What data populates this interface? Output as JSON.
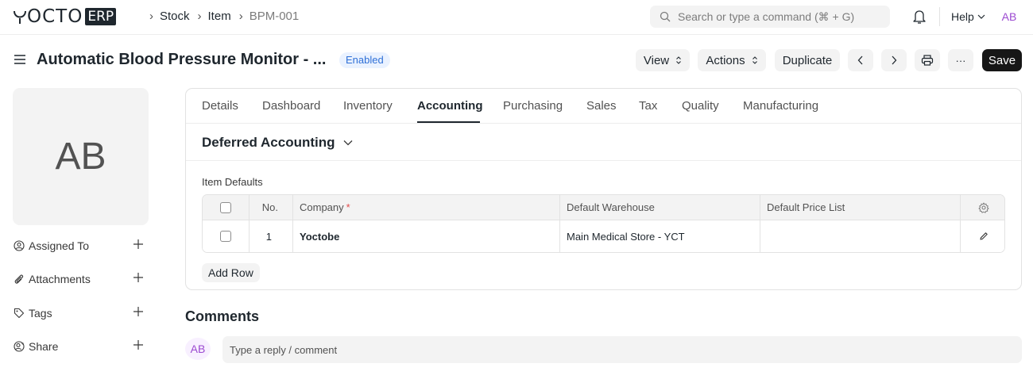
{
  "navbar": {
    "logo_text": "OCTO",
    "logo_badge": "ERP",
    "breadcrumbs": [
      "Stock",
      "Item",
      "BPM-001"
    ],
    "search_placeholder": "Search or type a command (⌘ + G)",
    "help_label": "Help",
    "avatar_initials": "AB"
  },
  "header": {
    "title": "Automatic Blood Pressure Monitor - ...",
    "status": "Enabled",
    "view_label": "View",
    "actions_label": "Actions",
    "duplicate_label": "Duplicate",
    "more_label": "···",
    "save_label": "Save"
  },
  "sidebar": {
    "image_initials": "AB",
    "items": [
      {
        "label": "Assigned To",
        "icon": "user-circle-icon"
      },
      {
        "label": "Attachments",
        "icon": "paperclip-icon"
      },
      {
        "label": "Tags",
        "icon": "tag-icon"
      },
      {
        "label": "Share",
        "icon": "share-user-icon"
      }
    ]
  },
  "tabs": [
    "Details",
    "Dashboard",
    "Inventory",
    "Accounting",
    "Purchasing",
    "Sales",
    "Tax",
    "Quality",
    "Manufacturing"
  ],
  "active_tab": "Accounting",
  "section": {
    "title": "Deferred Accounting"
  },
  "grid": {
    "label": "Item Defaults",
    "columns": {
      "no": "No.",
      "company": "Company",
      "warehouse": "Default Warehouse",
      "price_list": "Default Price List"
    },
    "required_mark": "*",
    "rows": [
      {
        "no": "1",
        "company": "Yoctobe",
        "warehouse": "Main Medical Store - YCT",
        "price_list": ""
      }
    ],
    "add_row_label": "Add Row"
  },
  "comments": {
    "title": "Comments",
    "avatar_initials": "AB",
    "placeholder": "Type a reply / comment"
  },
  "colors": {
    "accent_dark": "#171717",
    "status_blue": "#2f70d7",
    "avatar_purple": "#9c4ad1",
    "required_red": "#e24c4c"
  }
}
